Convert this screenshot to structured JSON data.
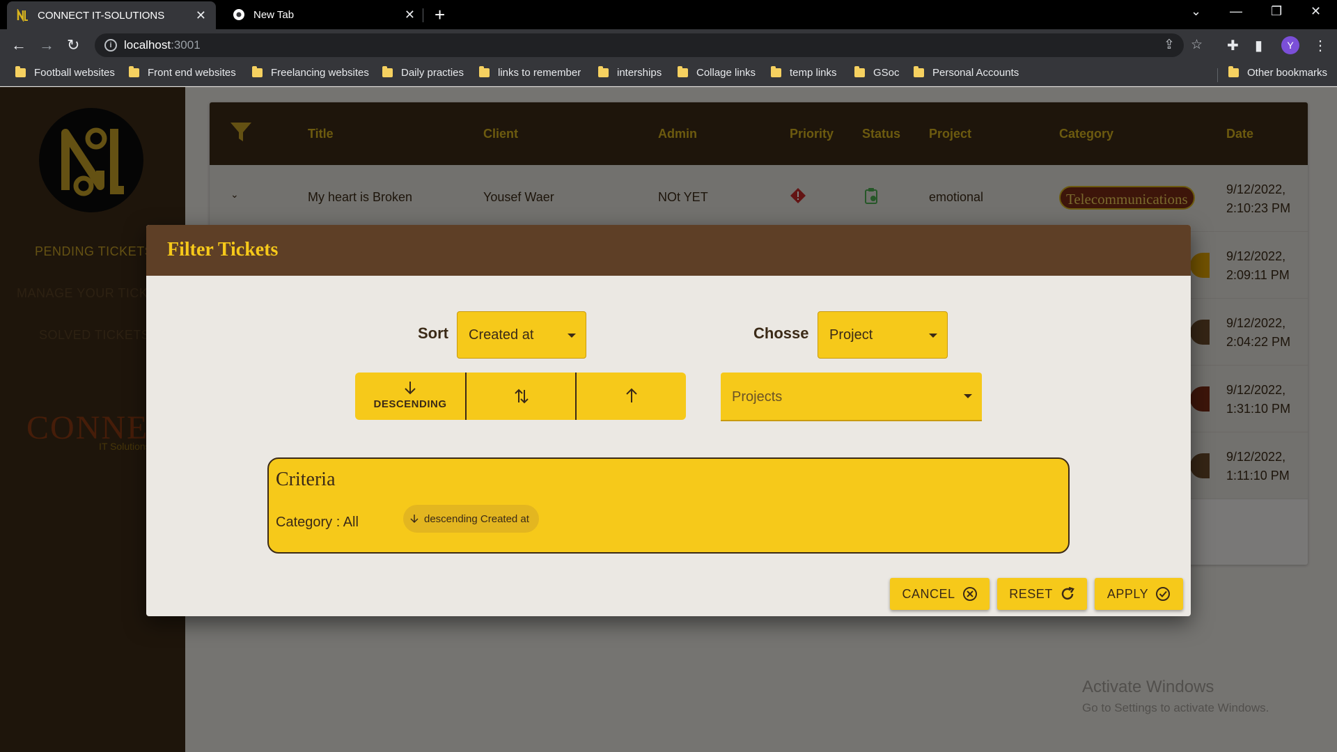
{
  "browser": {
    "tabs": [
      {
        "title": "CONNECT IT-SOLUTIONS",
        "active": true
      },
      {
        "title": "New Tab",
        "active": false
      }
    ],
    "address": {
      "host": "localhost",
      "port": ":3001"
    },
    "profile_initial": "Y",
    "bookmarks": [
      "Football websites",
      "Front end websites",
      "Freelancing websites",
      "Daily practies",
      "links to remember",
      "interships",
      "Collage links",
      "temp links",
      "GSoc",
      "Personal Accounts"
    ],
    "other_bookmarks": "Other bookmarks"
  },
  "sidebar": {
    "items": [
      "PENDING TICKETS",
      "MANAGE YOUR TICKETS",
      "SOLVED TICKETS"
    ],
    "brand": "CONNECT",
    "brand_sub": "IT Solutions"
  },
  "table": {
    "columns": [
      "Title",
      "Client",
      "Admin",
      "Priority",
      "Status",
      "Project",
      "Category",
      "Date"
    ],
    "first_row": {
      "title": "My heart is Broken",
      "client": "Yousef Waer",
      "admin": "NOt YET",
      "project": "emotional",
      "category": "Telecommunications",
      "date_line1": "9/12/2022,",
      "date_line2": "2:10:23 PM"
    },
    "dates": [
      [
        "9/12/2022,",
        "2:09:11 PM"
      ],
      [
        "9/12/2022,",
        "2:04:22 PM"
      ],
      [
        "9/12/2022,",
        "1:31:10 PM"
      ],
      [
        "9/12/2022,",
        "1:11:10 PM"
      ]
    ]
  },
  "dialog": {
    "title": "Filter Tickets",
    "sort_label": "Sort",
    "sort_value": "Created at",
    "choose_label": "Chosse",
    "choose_value": "Project",
    "descending_label": "DESCENDING",
    "projects_placeholder": "Projects",
    "criteria": {
      "title": "Criteria",
      "category": "Category : All",
      "chip": "descending Created at"
    },
    "actions": {
      "cancel": "CANCEL",
      "reset": "RESET",
      "apply": "APPLY"
    }
  },
  "watermark": {
    "line1": "Activate Windows",
    "line2": "Go to Settings to activate Windows."
  },
  "colors": {
    "accent": "#f6c91a",
    "dark_brown": "#3c2a17",
    "dialog_header": "#5e3f26",
    "category_chip": "#7a2b14"
  }
}
